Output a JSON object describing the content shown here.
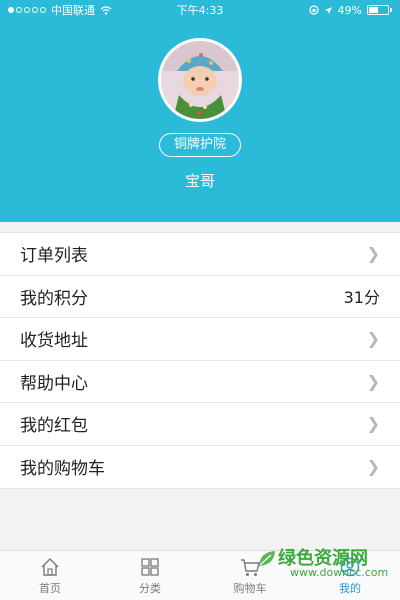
{
  "status_bar": {
    "carrier": "中国联通",
    "time": "下午4:33",
    "battery": "49%",
    "battery_level": 0.49,
    "signal_full": 1,
    "signal_total": 5
  },
  "profile": {
    "badge": "铜牌护院",
    "name": "宝哥"
  },
  "menu": [
    {
      "label": "订单列表",
      "value": ""
    },
    {
      "label": "我的积分",
      "value": "31分"
    },
    {
      "label": "收货地址",
      "value": ""
    },
    {
      "label": "帮助中心",
      "value": ""
    },
    {
      "label": "我的红包",
      "value": ""
    },
    {
      "label": "我的购物车",
      "value": ""
    }
  ],
  "tabs": [
    {
      "label": "首页",
      "icon": "home-icon"
    },
    {
      "label": "分类",
      "icon": "category-icon"
    },
    {
      "label": "购物车",
      "icon": "cart-icon"
    },
    {
      "label": "我的",
      "icon": "profile-icon",
      "active": true
    }
  ],
  "watermark": {
    "title": "绿色资源网",
    "url": "www.downcc.com"
  },
  "colors": {
    "header_bg": "#2bbbd9",
    "active_tab": "#1d9fd6",
    "watermark": "#3aa93a"
  }
}
